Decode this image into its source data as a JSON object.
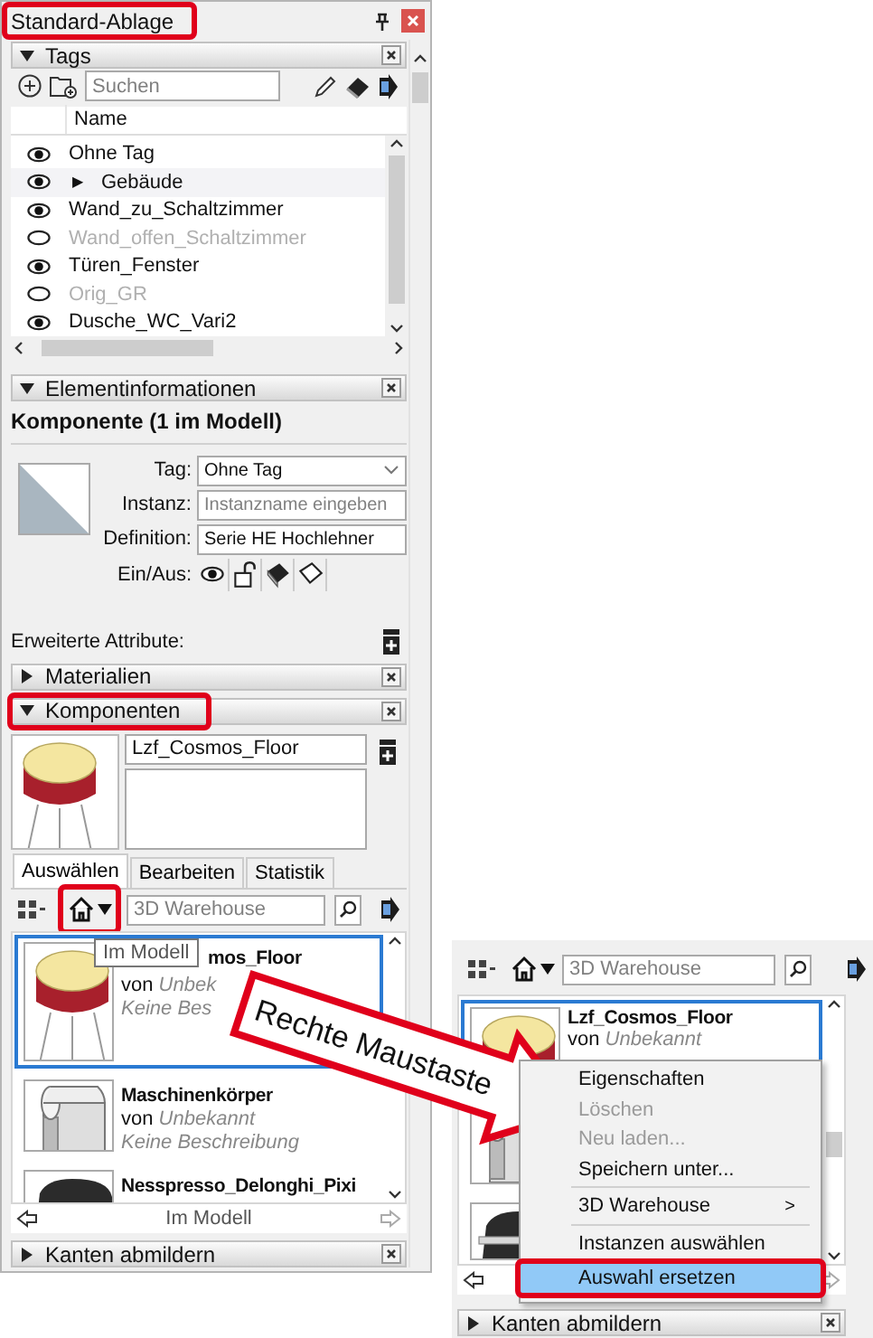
{
  "window": {
    "title": "Standard-Ablage",
    "highlighted": true
  },
  "tags": {
    "title": "Tags",
    "expanded": true,
    "search": {
      "placeholder": "Suchen"
    },
    "column": "Name",
    "rows": [
      {
        "name": "Ohne Tag",
        "visible": true,
        "selected": false
      },
      {
        "name": "Gebäude",
        "visible": true,
        "selected": true,
        "expander": "▶"
      },
      {
        "name": "Wand_zu_Schaltzimmer",
        "visible": true,
        "selected": false
      },
      {
        "name": "Wand_offen_Schaltzimmer",
        "visible": false,
        "selected": false
      },
      {
        "name": "Türen_Fenster",
        "visible": true,
        "selected": false
      },
      {
        "name": "Orig_GR",
        "visible": false,
        "selected": false
      },
      {
        "name": "Dusche_WC_Vari2",
        "visible": true,
        "selected": false
      }
    ]
  },
  "entity_info": {
    "title": "Elementinformationen",
    "expanded": true,
    "heading": "Komponente (1 im Modell)",
    "fields": [
      {
        "kind": "dropdown",
        "label": "Tag:",
        "value": "Ohne Tag"
      },
      {
        "kind": "input",
        "label": "Instanz:",
        "placeholder": "Instanzname eingeben"
      },
      {
        "kind": "input",
        "label": "Definition:",
        "value": "Serie HE Hochlehner"
      },
      {
        "kind": "toggles",
        "label": "Ein/Aus:"
      }
    ],
    "advanced_label": "Erweiterte Attribute:"
  },
  "materials": {
    "title": "Materialien",
    "expanded": false
  },
  "components": {
    "title": "Komponenten",
    "expanded": true,
    "highlighted": true,
    "name": "Lzf_Cosmos_Floor",
    "tabs": [
      {
        "label": "Auswählen",
        "selected": true
      },
      {
        "label": "Bearbeiten",
        "selected": false
      },
      {
        "label": "Statistik",
        "selected": false
      }
    ],
    "home_button": {
      "highlighted": true
    },
    "search": {
      "placeholder": "3D Warehouse"
    },
    "tooltip": "Im Modell",
    "items": [
      {
        "kind": "lamp",
        "name": "mos_Floor",
        "by": "von",
        "author": "Unbek",
        "description": "Keine Bes",
        "selected": true
      },
      {
        "kind": "machine",
        "name": "Maschinenkörper",
        "by": "von",
        "author": "Unbekannt",
        "description": "Keine Beschreibung",
        "selected": false
      },
      {
        "kind": "coffee",
        "name": "Nesspresso_Delonghi_Pixi",
        "selected": false
      }
    ],
    "footer": "Im Modell"
  },
  "soften_edges": {
    "title": "Kanten abmildern",
    "expanded": false
  },
  "callout": {
    "text": "Rechte Maustaste"
  },
  "inset": {
    "search": {
      "placeholder": "3D Warehouse"
    },
    "items": [
      {
        "kind": "lamp",
        "name": "Lzf_Cosmos_Floor",
        "by": "von",
        "author": "Unbekannt",
        "selected": true
      },
      {
        "kind": "machine",
        "selected": false
      },
      {
        "kind": "coffee",
        "selected": false
      }
    ],
    "menu": [
      {
        "kind": "item",
        "label": "Eigenschaften",
        "disabled": false,
        "selected": false
      },
      {
        "kind": "item",
        "label": "Löschen",
        "disabled": true,
        "selected": false
      },
      {
        "kind": "item",
        "label": "Neu laden...",
        "disabled": true,
        "selected": false
      },
      {
        "kind": "item",
        "label": "Speichern unter...",
        "disabled": false,
        "selected": false
      },
      {
        "kind": "separator"
      },
      {
        "kind": "item",
        "label": "3D Warehouse",
        "submenu": ">",
        "disabled": false,
        "selected": false
      },
      {
        "kind": "separator"
      },
      {
        "kind": "item",
        "label": "Instanzen auswählen",
        "disabled": false,
        "selected": false
      },
      {
        "kind": "item",
        "label": "Auswahl ersetzen",
        "disabled": false,
        "selected": true,
        "highlighted": true
      }
    ],
    "section": {
      "title": "Kanten abmildern",
      "expanded": false
    }
  }
}
